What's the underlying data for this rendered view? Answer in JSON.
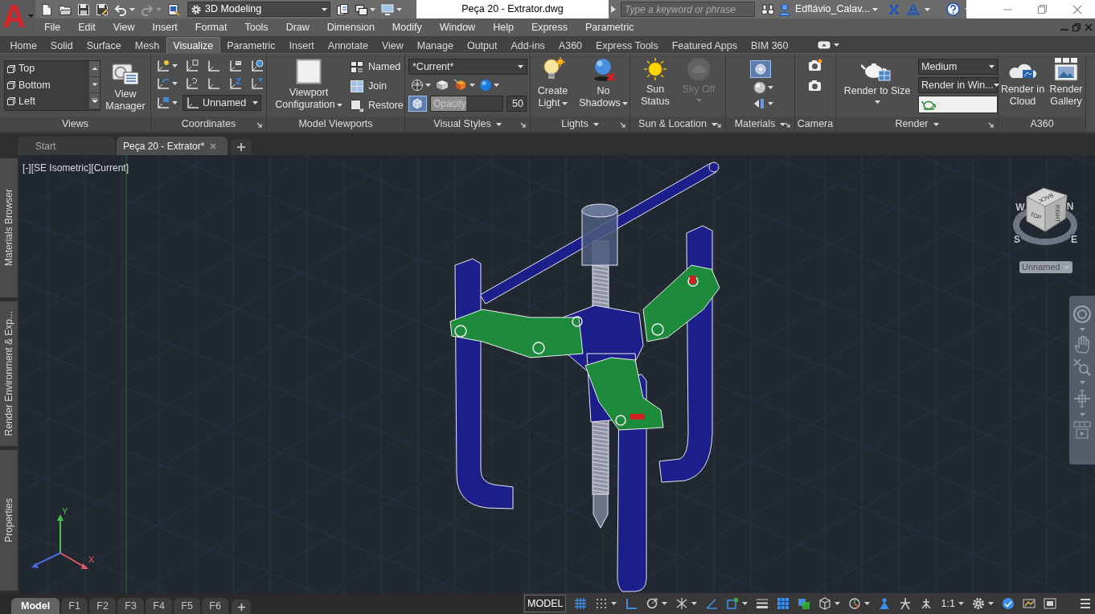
{
  "title_bar": {
    "app_button": "A",
    "quick_access": [
      {
        "kind": "new",
        "disabled": false
      },
      {
        "kind": "open",
        "disabled": false
      },
      {
        "kind": "save",
        "disabled": false
      },
      {
        "kind": "save_as",
        "disabled": false
      },
      {
        "kind": "undo",
        "disabled": false
      },
      {
        "kind": "redo",
        "disabled": true
      },
      {
        "kind": "plot",
        "disabled": false
      }
    ],
    "workspace": "3D Modeling",
    "quick_access_more": [
      {
        "kind": "sheet",
        "disabled": false
      },
      {
        "kind": "windows",
        "disabled": false
      },
      {
        "kind": "display",
        "disabled": false
      }
    ],
    "document_title": "Peça 20 - Extrator.dwg",
    "search": {
      "placeholder": "Type a keyword or phrase"
    },
    "user": "Edflávio_Calav..."
  },
  "menu_bar": [
    "File",
    "Edit",
    "View",
    "Insert",
    "Format",
    "Tools",
    "Draw",
    "Dimension",
    "Modify",
    "Window",
    "Help",
    "Express",
    "Parametric"
  ],
  "ribbon_tabs": [
    {
      "label": "Home",
      "selected": false
    },
    {
      "label": "Solid",
      "selected": false
    },
    {
      "label": "Surface",
      "selected": false
    },
    {
      "label": "Mesh",
      "selected": false
    },
    {
      "label": "Visualize",
      "selected": true
    },
    {
      "label": "Parametric",
      "selected": false
    },
    {
      "label": "Insert",
      "selected": false
    },
    {
      "label": "Annotate",
      "selected": false
    },
    {
      "label": "View",
      "selected": false
    },
    {
      "label": "Manage",
      "selected": false
    },
    {
      "label": "Output",
      "selected": false
    },
    {
      "label": "Add-ins",
      "selected": false
    },
    {
      "label": "A360",
      "selected": false
    },
    {
      "label": "Express Tools",
      "selected": false
    },
    {
      "label": "Featured Apps",
      "selected": false
    },
    {
      "label": "BIM 360",
      "selected": false
    }
  ],
  "ribbon": {
    "views": {
      "title": "Views",
      "list": [
        "Top",
        "Bottom",
        "Left"
      ],
      "button": "View Manager"
    },
    "coordinates": {
      "title": "Coordinates",
      "launcher": true,
      "ucs_dropdown": "Unnamed"
    },
    "model_viewports": {
      "title": "Model Viewports",
      "config_button": "Viewport Configuration",
      "buttons": [
        "Named",
        "Join",
        "Restore"
      ]
    },
    "visual_styles": {
      "title": "Visual Styles",
      "menu": true,
      "launcher": true,
      "style_dropdown": "*Current*",
      "xray_on": true,
      "opacity": {
        "label": "Opacity",
        "level": 0.5,
        "reading": "50"
      }
    },
    "lights": {
      "title": "Lights",
      "menu": true,
      "launcher": true,
      "buttons": [
        "Create Light",
        "No Shadows"
      ]
    },
    "sun_location": {
      "title": "Sun & Location",
      "menu": true,
      "launcher": true,
      "buttons": [
        {
          "label": "Sun Status",
          "disabled": false
        },
        {
          "label": "Sky Off",
          "disabled": true
        }
      ]
    },
    "materials": {
      "title": "Materials",
      "menu": true,
      "launcher": true,
      "browser_on": true
    },
    "camera": {
      "title": "Camera"
    },
    "render": {
      "title": "Render",
      "menu": true,
      "launcher": true,
      "button": "Render to Size",
      "preset": "Medium",
      "destination": "Render in Win..."
    },
    "a360": {
      "title": "A360",
      "buttons": [
        "Render in Cloud",
        "Render Gallery"
      ]
    }
  },
  "document_tabs": [
    {
      "label": "Start",
      "selected": false
    },
    {
      "label": "Peça 20 - Extrator*",
      "selected": true
    }
  ],
  "side_palettes": [
    "Materials Browser",
    "Render Environment & Exp...",
    "Properties"
  ],
  "viewport": {
    "label": "[-][SE Isometric][Current]",
    "viewcube": {
      "faces": [
        "BACK",
        "TOP",
        "RIGHT"
      ],
      "compass": [
        "W",
        "N",
        "S",
        "E"
      ],
      "ucs_menu": "Unnamed"
    },
    "ucs_axes": [
      "Y",
      "X"
    ]
  },
  "layout_tabs": [
    {
      "label": "Model",
      "selected": true
    },
    {
      "label": "F1",
      "selected": false
    },
    {
      "label": "F2",
      "selected": false
    },
    {
      "label": "F3",
      "selected": false
    },
    {
      "label": "F4",
      "selected": false
    },
    {
      "label": "F5",
      "selected": false
    },
    {
      "label": "F6",
      "selected": false
    }
  ],
  "status_bar": {
    "model_button": "MODEL",
    "tools": [
      {
        "kind": "grid",
        "on": true
      },
      {
        "kind": "snap",
        "on": false
      },
      {
        "kind": "ortho",
        "on": true
      },
      {
        "kind": "polar",
        "on": false
      },
      {
        "kind": "isodraft",
        "on": false
      },
      {
        "kind": "tracking",
        "on": true
      },
      {
        "kind": "osnap",
        "on": true
      },
      {
        "kind": "lineweight",
        "on": false
      },
      {
        "kind": "transparency",
        "on": true
      },
      {
        "kind": "selection_cycling",
        "on": true
      },
      {
        "kind": "osnap3d",
        "on": false
      },
      {
        "kind": "gizmo",
        "on": false
      },
      {
        "kind": "annotation_visibility",
        "on": true
      },
      {
        "kind": "autoscale",
        "on": false
      },
      {
        "kind": "annotation_scale",
        "on": false
      },
      {
        "kind": "scale",
        "label": "1:1",
        "on": false
      },
      {
        "kind": "workspace",
        "on": false
      },
      {
        "kind": "isolate",
        "on": true
      },
      {
        "kind": "hardware",
        "on": false
      },
      {
        "kind": "clean_screen",
        "on": false
      },
      {
        "kind": "customize",
        "on": false
      }
    ]
  }
}
